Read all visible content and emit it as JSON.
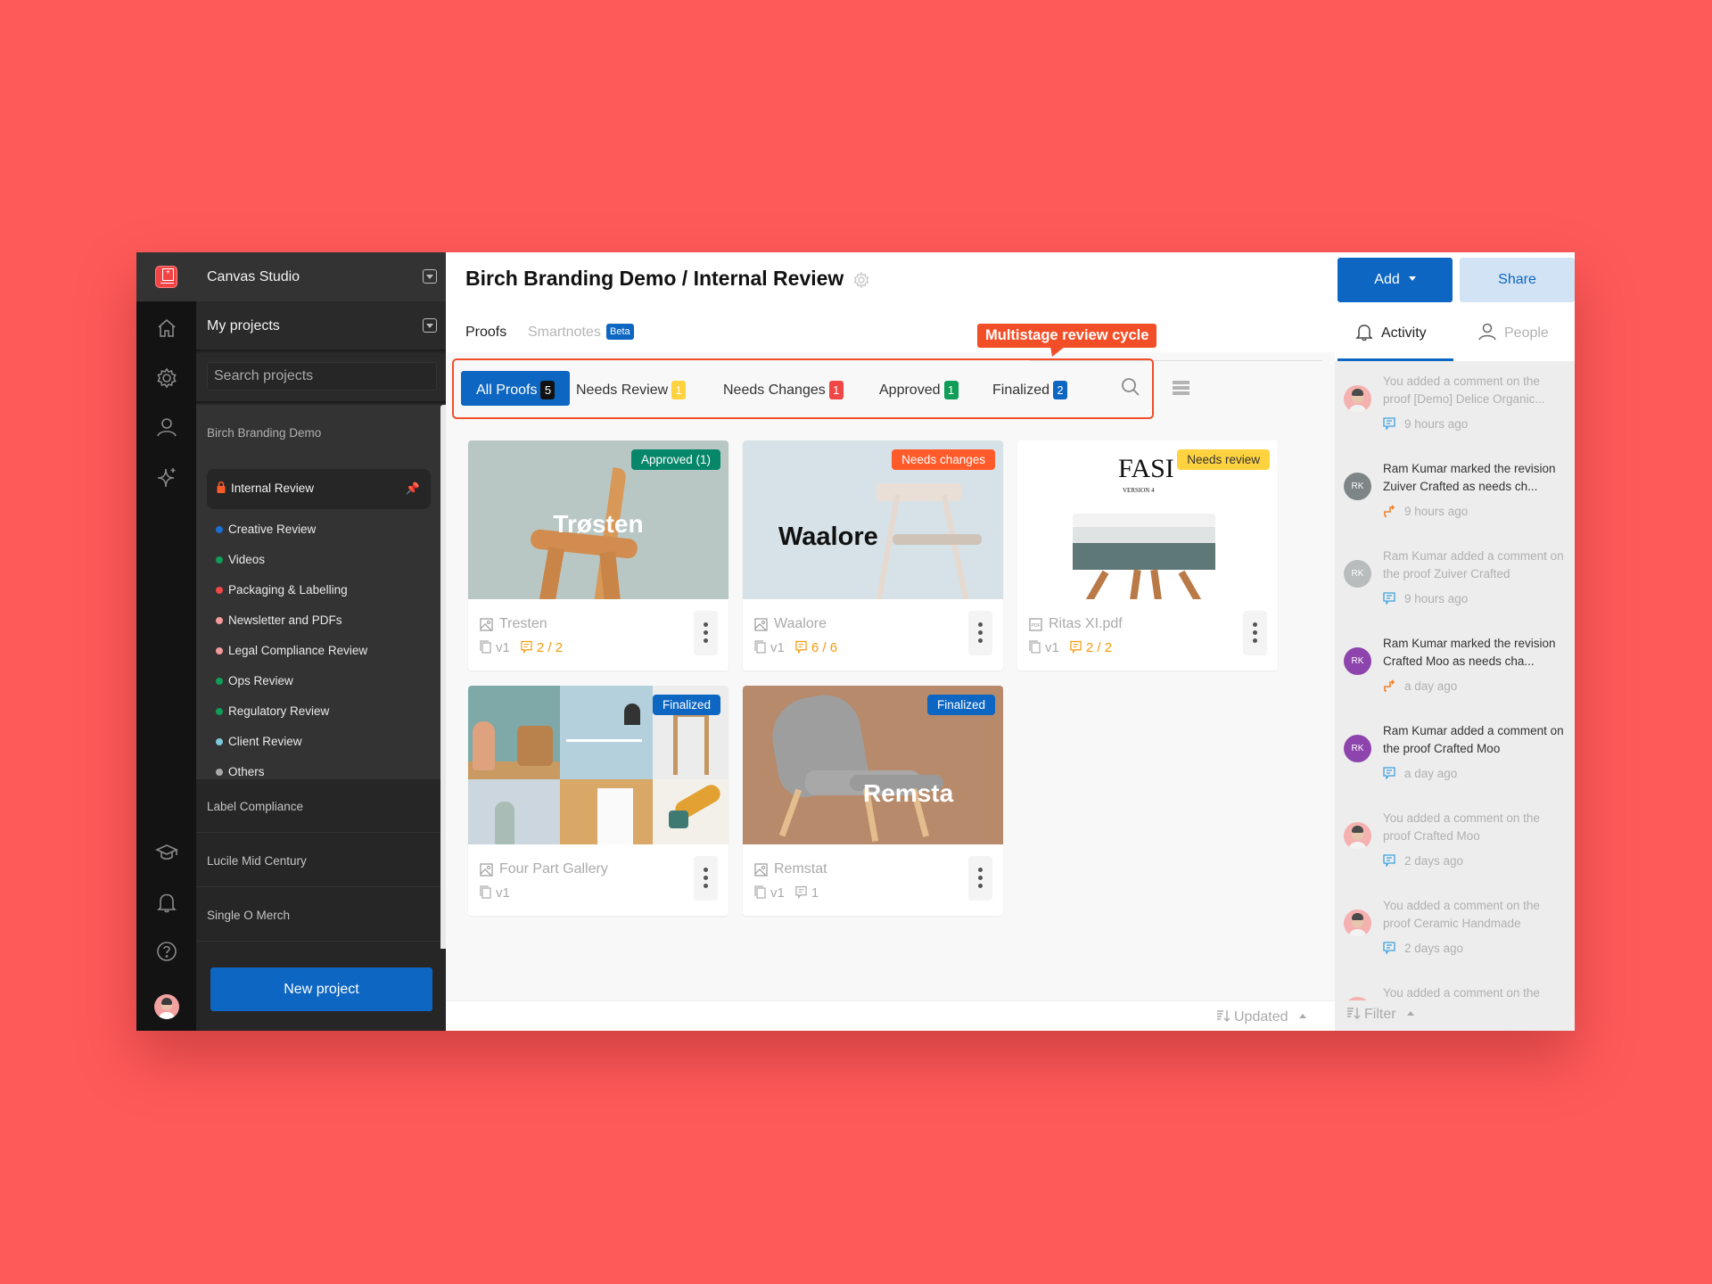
{
  "sidebar": {
    "workspace_name": "Canvas Studio",
    "section_title": "My projects",
    "search_placeholder": "Search projects",
    "group_title": "Birch Branding Demo",
    "active_item": "Internal Review",
    "items": [
      {
        "label": "Creative Review",
        "color": "#1a6fd1"
      },
      {
        "label": "Videos",
        "color": "#0f9d58"
      },
      {
        "label": "Packaging & Labelling",
        "color": "#f04747"
      },
      {
        "label": "Newsletter and PDFs",
        "color": "#f59a9a"
      },
      {
        "label": "Legal Compliance Review",
        "color": "#f59a9a"
      },
      {
        "label": "Ops Review",
        "color": "#0f9d58"
      },
      {
        "label": "Regulatory Review",
        "color": "#0f9d58"
      },
      {
        "label": "Client Review",
        "color": "#7cc8dc"
      },
      {
        "label": "Others",
        "color": "#a8a8a8"
      }
    ],
    "projects": [
      "Label Compliance",
      "Lucile Mid Century",
      "Single O Merch"
    ],
    "new_project_label": "New project"
  },
  "header": {
    "title": "Birch Branding Demo / Internal Review",
    "tabs": {
      "proofs": "Proofs",
      "smartnotes": "Smartnotes",
      "beta": "Beta"
    },
    "add_label": "Add",
    "share_label": "Share"
  },
  "callout": "Multistage review cycle",
  "filters": [
    {
      "label": "All Proofs",
      "count": "5",
      "badge_bg": "#111111",
      "badge_fg": "#ffffff"
    },
    {
      "label": "Needs Review",
      "count": "1",
      "badge_bg": "#ffd23f",
      "badge_fg": "#ffffff"
    },
    {
      "label": "Needs Changes",
      "count": "1",
      "badge_bg": "#f04747",
      "badge_fg": "#ffffff"
    },
    {
      "label": "Approved",
      "count": "1",
      "badge_bg": "#0f9d58",
      "badge_fg": "#ffffff"
    },
    {
      "label": "Finalized",
      "count": "2",
      "badge_bg": "#0d66c2",
      "badge_fg": "#ffffff"
    }
  ],
  "proofs": [
    {
      "name": "Tresten",
      "type": "image",
      "status": "Approved (1)",
      "status_color": "#07876a",
      "status_fg": "#ffffff",
      "version": "v1",
      "comments": "2 / 2",
      "comments_highlight": true,
      "thumb_text": "Trøsten"
    },
    {
      "name": "Waalore",
      "type": "image",
      "status": "Needs changes",
      "status_color": "#ff5a2a",
      "status_fg": "#ffffff",
      "version": "v1",
      "comments": "6 / 6",
      "comments_highlight": true,
      "thumb_text": "Waalore"
    },
    {
      "name": "Ritas XI.pdf",
      "type": "pdf",
      "status": "Needs review",
      "status_color": "#ffd23f",
      "status_fg": "#333333",
      "version": "v1",
      "comments": "2 / 2",
      "comments_highlight": true,
      "thumb_text": "FASI",
      "thumb_subtext": "VERSION 4"
    },
    {
      "name": "Four Part Gallery",
      "type": "image",
      "status": "Finalized",
      "status_color": "#0d66c2",
      "status_fg": "#ffffff",
      "version": "v1",
      "comments": null,
      "comments_highlight": false
    },
    {
      "name": "Remstat",
      "type": "image",
      "status": "Finalized",
      "status_color": "#0d66c2",
      "status_fg": "#ffffff",
      "version": "v1",
      "comments": "1",
      "comments_highlight": false,
      "thumb_text": "Remsta"
    }
  ],
  "sort": {
    "label": "Updated"
  },
  "activity_panel": {
    "tabs": {
      "activity": "Activity",
      "people": "People"
    },
    "items": [
      {
        "avatar": "photo",
        "initials": "",
        "avatar_color": "",
        "text": "You added a comment on the proof [Demo] Delice Organic...",
        "emphasis": false,
        "kind": "comment",
        "time": "9 hours ago"
      },
      {
        "avatar": "initials",
        "initials": "RK",
        "avatar_color": "#7d8587",
        "text": "Ram Kumar marked the revision Zuiver Crafted as needs ch...",
        "emphasis": true,
        "kind": "status",
        "time": "9 hours ago"
      },
      {
        "avatar": "initials",
        "initials": "RK",
        "avatar_color": "#b8bcbd",
        "text": "Ram Kumar added a comment on the proof Zuiver Crafted",
        "emphasis": false,
        "kind": "comment",
        "time": "9 hours ago"
      },
      {
        "avatar": "initials",
        "initials": "RK",
        "avatar_color": "#8e44ad",
        "text": "Ram Kumar marked the revision Crafted Moo as needs cha...",
        "emphasis": true,
        "kind": "status",
        "time": "a day ago"
      },
      {
        "avatar": "initials",
        "initials": "RK",
        "avatar_color": "#8e44ad",
        "text": "Ram Kumar added a comment on the proof Crafted Moo",
        "emphasis": true,
        "kind": "comment",
        "time": "a day ago"
      },
      {
        "avatar": "photo",
        "initials": "",
        "avatar_color": "",
        "text": "You added a comment on the proof Crafted Moo",
        "emphasis": false,
        "kind": "comment",
        "time": "2 days ago"
      },
      {
        "avatar": "photo",
        "initials": "",
        "avatar_color": "",
        "text": "You added a comment on the proof Ceramic Handmade",
        "emphasis": false,
        "kind": "comment",
        "time": "2 days ago"
      },
      {
        "avatar": "photo",
        "initials": "",
        "avatar_color": "",
        "text": "You added a comment on the",
        "emphasis": false,
        "kind": "comment",
        "time": ""
      }
    ],
    "filter_label": "Filter"
  },
  "colors": {
    "accent": "#0d66c2",
    "callout": "#f24e27",
    "background": "#ff5a5a"
  }
}
